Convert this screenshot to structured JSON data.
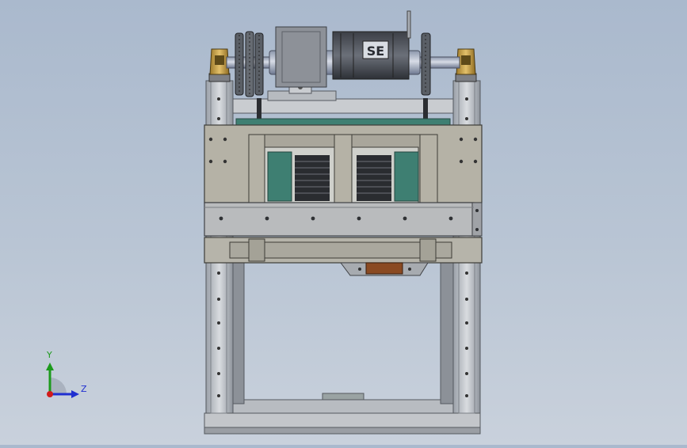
{
  "colors": {
    "background_top": "#aab9cd",
    "frame": "#c6c9cd",
    "frame_dark": "#6b6f75",
    "plate": "#b5b2a6",
    "teal": "#3e7f72",
    "brass": "#c9a347",
    "copper": "#8a4a22",
    "axis_x": "#d11b1b",
    "axis_y": "#1c9a1c",
    "axis_z": "#1f2fd0"
  },
  "model": {
    "motor_label": "SE"
  },
  "triad": {
    "y_label": "Y",
    "z_label": "Z"
  }
}
